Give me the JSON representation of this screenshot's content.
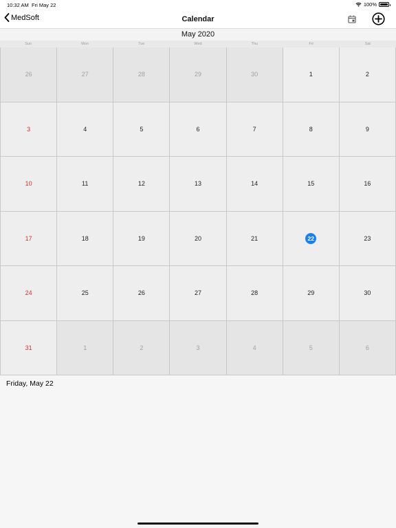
{
  "status_bar": {
    "time": "10:32 AM",
    "date": "Fri May 22",
    "battery": "100%",
    "battery_level": 1.0
  },
  "nav": {
    "back_label": "MedSoft",
    "title": "Calendar"
  },
  "calendar": {
    "month_label": "May 2020",
    "weekdays": [
      "Sun",
      "Mon",
      "Tue",
      "Wed",
      "Thu",
      "Fri",
      "Sat"
    ],
    "weeks": [
      [
        {
          "d": "26",
          "other": true
        },
        {
          "d": "27",
          "other": true
        },
        {
          "d": "28",
          "other": true
        },
        {
          "d": "29",
          "other": true
        },
        {
          "d": "30",
          "other": true
        },
        {
          "d": "1"
        },
        {
          "d": "2"
        }
      ],
      [
        {
          "d": "3"
        },
        {
          "d": "4"
        },
        {
          "d": "5"
        },
        {
          "d": "6"
        },
        {
          "d": "7"
        },
        {
          "d": "8"
        },
        {
          "d": "9"
        }
      ],
      [
        {
          "d": "10"
        },
        {
          "d": "11"
        },
        {
          "d": "12"
        },
        {
          "d": "13"
        },
        {
          "d": "14"
        },
        {
          "d": "15"
        },
        {
          "d": "16"
        }
      ],
      [
        {
          "d": "17"
        },
        {
          "d": "18"
        },
        {
          "d": "19"
        },
        {
          "d": "20"
        },
        {
          "d": "21"
        },
        {
          "d": "22",
          "today": true
        },
        {
          "d": "23"
        }
      ],
      [
        {
          "d": "24"
        },
        {
          "d": "25"
        },
        {
          "d": "26"
        },
        {
          "d": "27"
        },
        {
          "d": "28"
        },
        {
          "d": "29"
        },
        {
          "d": "30"
        }
      ],
      [
        {
          "d": "31"
        },
        {
          "d": "1",
          "other": true
        },
        {
          "d": "2",
          "other": true
        },
        {
          "d": "3",
          "other": true
        },
        {
          "d": "4",
          "other": true
        },
        {
          "d": "5",
          "other": true
        },
        {
          "d": "6",
          "other": true
        }
      ]
    ],
    "colors": {
      "sunday": "#d32f2f",
      "today": "#1a7ff0"
    }
  },
  "selected_date_label": "Friday, May 22",
  "icons": {
    "back": "chevron-left-icon",
    "today": "calendar-today-icon",
    "add": "plus-circle-icon",
    "wifi": "wifi-icon",
    "battery": "battery-icon"
  }
}
